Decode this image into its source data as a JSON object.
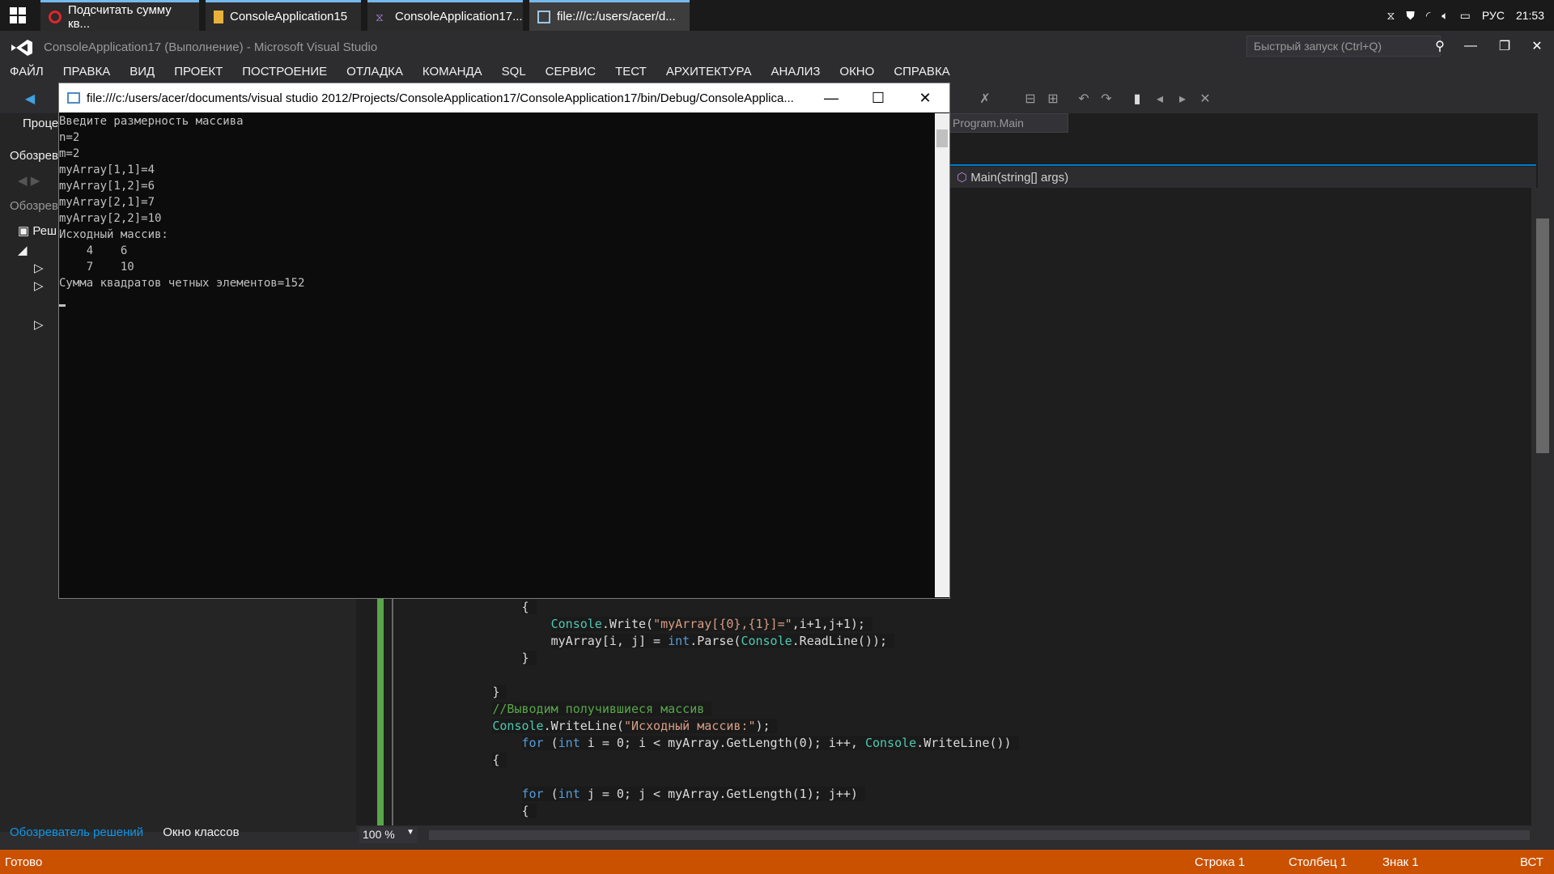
{
  "taskbar": {
    "tabs": [
      {
        "label": "Подсчитать сумму кв...",
        "icon": "opera-icon"
      },
      {
        "label": "ConsoleApplication15",
        "icon": "folder-icon"
      },
      {
        "label": "ConsoleApplication17...",
        "icon": "visual-studio-icon"
      },
      {
        "label": "file:///c:/users/acer/d...",
        "icon": "console-app-icon"
      }
    ],
    "tray": {
      "language": "РУС",
      "time": "21:53"
    }
  },
  "window": {
    "title": "ConsoleApplication17 (Выполнение) - Microsoft Visual Studio",
    "quick_launch_placeholder": "Быстрый запуск (Ctrl+Q)"
  },
  "menu": [
    "ФАЙЛ",
    "ПРАВКА",
    "ВИД",
    "ПРОЕКТ",
    "ПОСТРОЕНИЕ",
    "ОТЛАДКА",
    "КОМАНДА",
    "SQL",
    "СЕРВИС",
    "ТЕСТ",
    "АРХИТЕКТУРА",
    "АНАЛИЗ",
    "ОКНО",
    "СПРАВКА"
  ],
  "left_panel": {
    "process_label": "Проце",
    "browser_label1": "Обозрев",
    "browser_label2": "Обозрев",
    "solution_label": "Реш",
    "tabs": [
      "Обозреватель решений",
      "Окно классов"
    ]
  },
  "editor": {
    "nav_combo": "Program.Main",
    "member_combo": "Main(string[] args)",
    "zoom": "100 %"
  },
  "code_lines": [
    {
      "indent": "                ",
      "text": "{"
    },
    {
      "indent": "                    ",
      "text": "Console.Write(\"myArray[{0},{1}]=\",i+1,j+1);"
    },
    {
      "indent": "                    ",
      "text": "myArray[i, j] = int.Parse(Console.ReadLine());"
    },
    {
      "indent": "                ",
      "text": "}"
    },
    {
      "indent": "",
      "text": ""
    },
    {
      "indent": "            ",
      "text": "}"
    },
    {
      "indent": "            ",
      "text": "//Выводим получившиеся массив"
    },
    {
      "indent": "            ",
      "text": "Console.WriteLine(\"Исходный массив:\");"
    },
    {
      "indent": "                ",
      "text": "for (int i = 0; i < myArray.GetLength(0); i++, Console.WriteLine())"
    },
    {
      "indent": "            ",
      "text": "{"
    },
    {
      "indent": "",
      "text": ""
    },
    {
      "indent": "                ",
      "text": "for (int j = 0; j < myArray.GetLength(1); j++)"
    },
    {
      "indent": "                ",
      "text": "{"
    }
  ],
  "console": {
    "title": "file:///c:/users/acer/documents/visual studio 2012/Projects/ConsoleApplication17/ConsoleApplication17/bin/Debug/ConsoleApplica...",
    "output": "Введите размерность массива\nn=2\nm=2\nmyArray[1,1]=4\nmyArray[1,2]=6\nmyArray[2,1]=7\nmyArray[2,2]=10\nИсходный массив:\n    4    6\n    7    10\nСумма квадратов четных элементов=152"
  },
  "status": {
    "ready": "Готово",
    "row": "Строка 1",
    "col": "Столбец 1",
    "char": "Знак 1",
    "mode": "ВСТ"
  },
  "colors": {
    "status_bar": "#ca5100",
    "accent": "#007acc"
  }
}
